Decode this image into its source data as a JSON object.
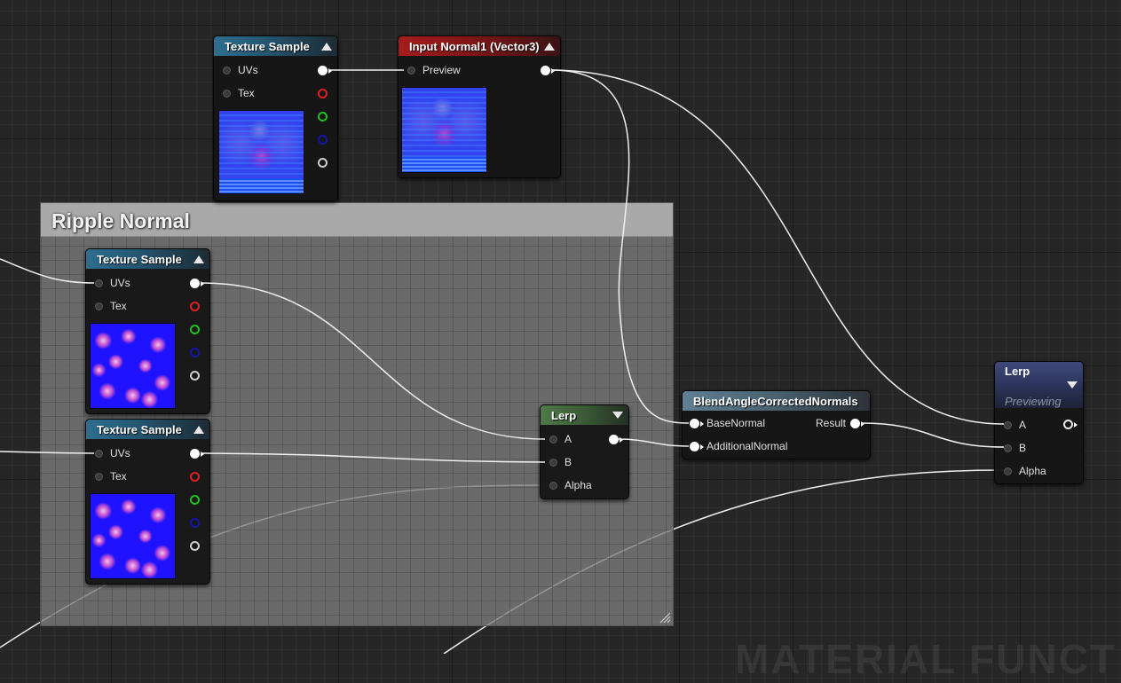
{
  "nodes": {
    "texture_sample_top": {
      "title": "Texture Sample",
      "pins": {
        "uvs": "UVs",
        "tex": "Tex"
      }
    },
    "input_normal": {
      "title": "Input Normal1 (Vector3)",
      "pins": {
        "preview": "Preview"
      }
    },
    "texture_sample_ripple_1": {
      "title": "Texture Sample",
      "pins": {
        "uvs": "UVs",
        "tex": "Tex"
      }
    },
    "texture_sample_ripple_2": {
      "title": "Texture Sample",
      "pins": {
        "uvs": "UVs",
        "tex": "Tex"
      }
    },
    "lerp_small": {
      "title": "Lerp",
      "pins": {
        "a": "A",
        "b": "B",
        "alpha": "Alpha"
      }
    },
    "blend": {
      "title": "BlendAngleCorrectedNormals",
      "pins": {
        "base_normal": "BaseNormal",
        "additional_normal": "AdditionalNormal",
        "result": "Result"
      }
    },
    "lerp_big": {
      "title": "Lerp",
      "subtitle": "Previewing",
      "pins": {
        "a": "A",
        "b": "B",
        "alpha": "Alpha"
      }
    }
  },
  "comment_box": {
    "title": "Ripple Normal"
  },
  "watermark": "MATERIAL FUNCT",
  "colors": {
    "texture_header": "#2e6e8e",
    "input_header": "#a61c1c",
    "lerp_header": "#4f7a48",
    "blend_header": "#5f7f93",
    "lerp_preview_header": "#3d4a7a",
    "pin_red": "#e02020",
    "pin_green": "#20c020",
    "pin_blue": "#1414a8",
    "pin_white": "#ffffff",
    "wire": "#f0f0f0"
  },
  "icons": [
    "collapse-arrow-icon",
    "expand-arrow-icon",
    "resize-grip-icon",
    "exec-pin-icon"
  ]
}
